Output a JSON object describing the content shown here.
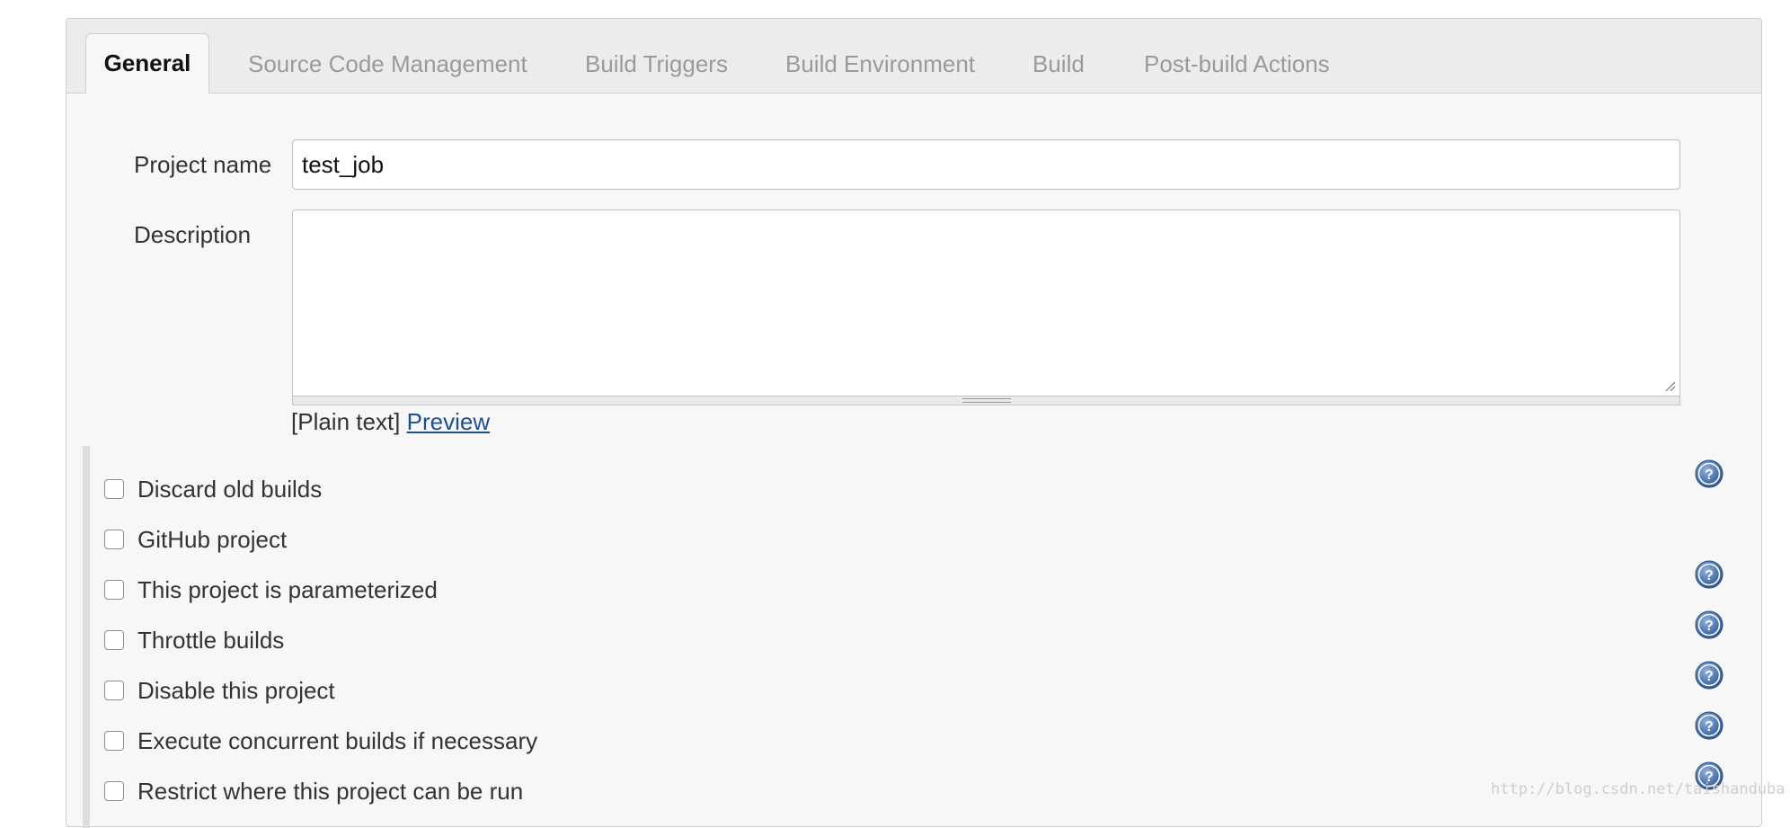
{
  "tabs": {
    "general": "General",
    "scm": "Source Code Management",
    "triggers": "Build Triggers",
    "environment": "Build Environment",
    "build": "Build",
    "post_build": "Post-build Actions"
  },
  "form": {
    "project_name_label": "Project name",
    "project_name_value": "test_job",
    "description_label": "Description",
    "description_value": "",
    "format_prefix": "[Plain text]",
    "preview_link": "Preview"
  },
  "options": [
    {
      "label": "Discard old builds",
      "checked": false,
      "help": true
    },
    {
      "label": "GitHub project",
      "checked": false,
      "help": false
    },
    {
      "label": "This project is parameterized",
      "checked": false,
      "help": true
    },
    {
      "label": "Throttle builds",
      "checked": false,
      "help": true
    },
    {
      "label": "Disable this project",
      "checked": false,
      "help": true
    },
    {
      "label": "Execute concurrent builds if necessary",
      "checked": false,
      "help": true
    },
    {
      "label": "Restrict where this project can be run",
      "checked": false,
      "help": true
    }
  ],
  "icons": {
    "help": "help-question-icon",
    "checkbox": "checkbox-unchecked"
  },
  "colors": {
    "link": "#1d4f91",
    "help_icon": "#3b67a5",
    "panel_bg": "#f7f7f7",
    "tab_inactive_text": "#9a9a9a"
  },
  "watermark": "http://blog.csdn.net/taishanduba"
}
